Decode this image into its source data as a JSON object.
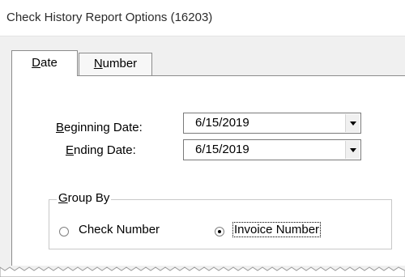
{
  "window": {
    "title": "Check History Report Options (16203)"
  },
  "tabs": [
    {
      "label_mnemonic": "D",
      "label_rest": "ate",
      "active": true
    },
    {
      "label_mnemonic": "N",
      "label_rest": "umber",
      "active": false
    }
  ],
  "fields": {
    "beginning_date": {
      "label_mnemonic": "B",
      "label_rest": "eginning Date:",
      "value": "6/15/2019"
    },
    "ending_date": {
      "label_mnemonic": "E",
      "label_rest": "nding Date:",
      "value": "6/15/2019"
    }
  },
  "group_by": {
    "legend_mnemonic": "G",
    "legend_rest": "roup By",
    "options": [
      {
        "label": "Check Number",
        "selected": false
      },
      {
        "label": "Invoice Number",
        "selected": true
      }
    ]
  },
  "colors": {
    "window_bg": "#f0f0f0",
    "panel_bg": "#ffffff",
    "border": "#8c8c8c"
  }
}
